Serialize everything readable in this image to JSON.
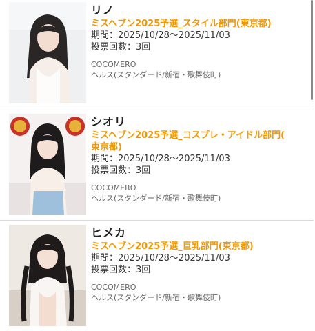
{
  "entries": [
    {
      "name": "リノ",
      "event": "ミスヘブン2025予選_スタイル部門(東京都)",
      "period": "期間：2025/10/28〜2025/11/03",
      "votes": "投票回数：3回",
      "shop": "COCOMERO",
      "category": "ヘルス(スタンダード/新宿・歌舞伎町)"
    },
    {
      "name": "シオリ",
      "event_line1": "ミスヘブン2025予選_コスプレ・アイドル部門(",
      "event_line2": "東京都)",
      "period": "期間：2025/10/28〜2025/11/03",
      "votes": "投票回数：3回",
      "shop": "COCOMERO",
      "category": "ヘルス(スタンダード/新宿・歌舞伎町)"
    },
    {
      "name": "ヒメカ",
      "event": "ミスヘブン2025予選_巨乳部門(東京都)",
      "period": "期間：2025/10/28〜2025/11/03",
      "votes": "投票回数：3回",
      "shop": "COCOMERO",
      "category": "ヘルス(スタンダード/新宿・歌舞伎町)"
    }
  ],
  "colors": {
    "accent": "#f39800",
    "divider": "#d9d9d9"
  }
}
